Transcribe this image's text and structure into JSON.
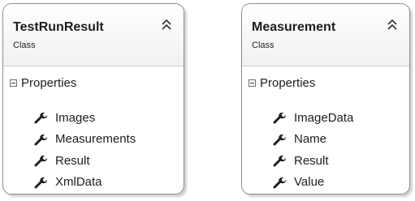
{
  "classes": [
    {
      "name": "TestRunResult",
      "kind": "Class",
      "section": "Properties",
      "properties": [
        "Images",
        "Measurements",
        "Result",
        "XmlData"
      ]
    },
    {
      "name": "Measurement",
      "kind": "Class",
      "section": "Properties",
      "properties": [
        "ImageData",
        "Name",
        "Result",
        "Value"
      ]
    }
  ],
  "icons": {
    "collapse": "double-chevron-up-icon",
    "section_toggle": "minus-box-icon",
    "property": "wrench-icon"
  },
  "colors": {
    "border": "#8c8c8c",
    "text": "#1e1e1e",
    "icon": "#1e1e1e"
  }
}
